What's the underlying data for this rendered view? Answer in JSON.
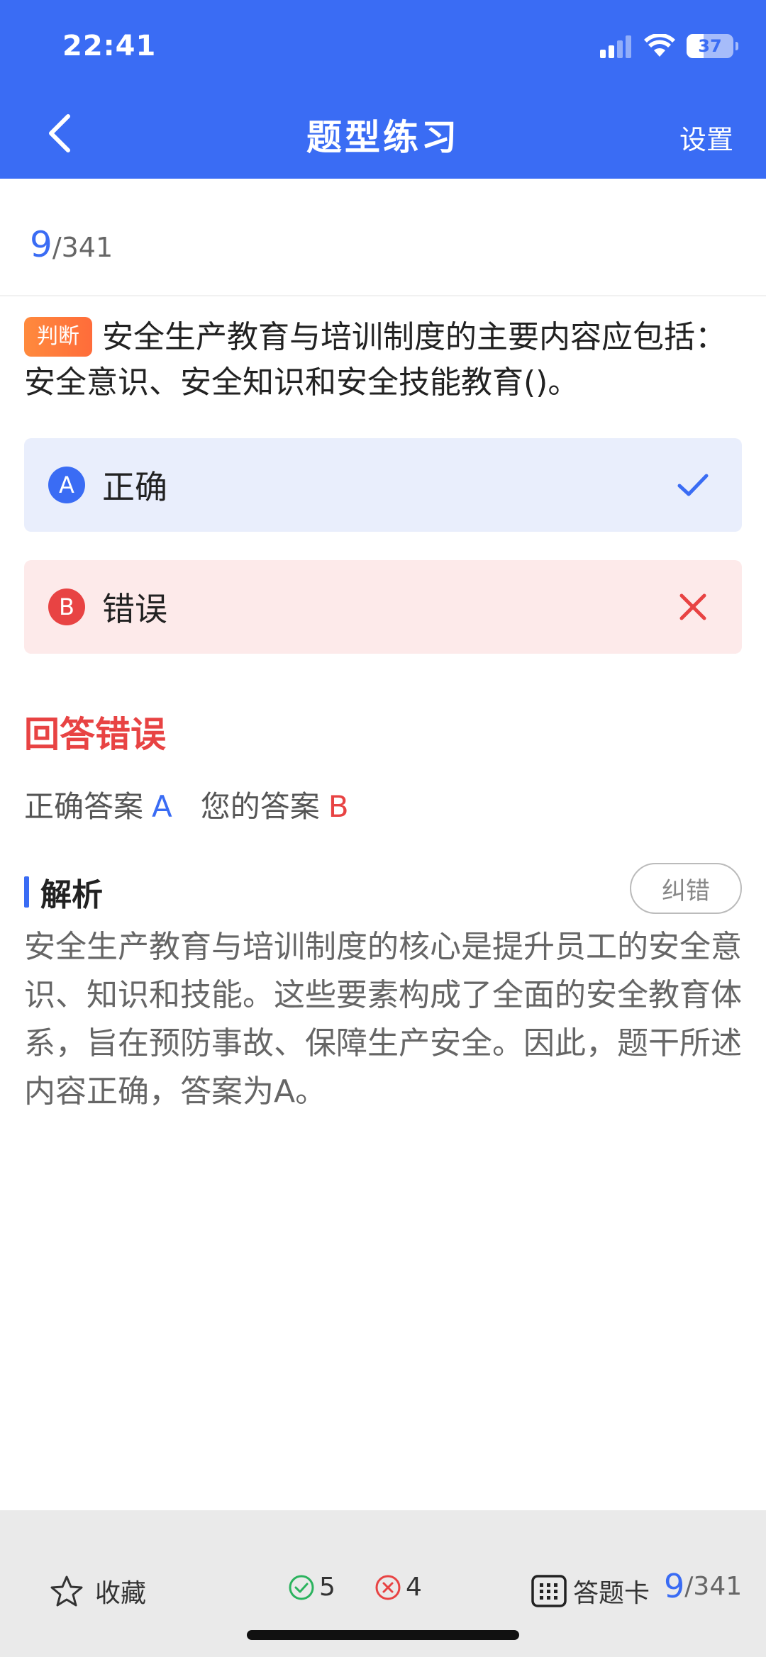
{
  "status_bar": {
    "time": "22:41",
    "battery": "37",
    "battery_level": 0.37
  },
  "nav": {
    "title": "题型练习",
    "settings_label": "设置"
  },
  "progress": {
    "current": "9",
    "total": "/341"
  },
  "question": {
    "type_tag": "判断",
    "text": "安全生产教育与培训制度的主要内容应包括：安全意识、安全知识和安全技能教育()。"
  },
  "options": [
    {
      "letter": "A",
      "text": "正确",
      "state": "correct"
    },
    {
      "letter": "B",
      "text": "错误",
      "state": "wrong"
    }
  ],
  "result": {
    "title": "回答错误",
    "correct_label": "正确答案",
    "correct_value": "A",
    "yours_label": "您的答案",
    "yours_value": "B"
  },
  "analysis": {
    "title": "解析",
    "report_label": "纠错",
    "text": "安全生产教育与培训制度的核心是提升员工的安全意识、知识和技能。这些要素构成了全面的安全教育体系，旨在预防事故、保障生产安全。因此，题干所述内容正确，答案为A。"
  },
  "bottom_bar": {
    "favorite_label": "收藏",
    "right_count": "5",
    "wrong_count": "4",
    "card_label": "答题卡",
    "current": "9",
    "total": "/341"
  },
  "colors": {
    "accent": "#3a6cf4",
    "error": "#e84343",
    "tag": "#ff7a3a"
  }
}
